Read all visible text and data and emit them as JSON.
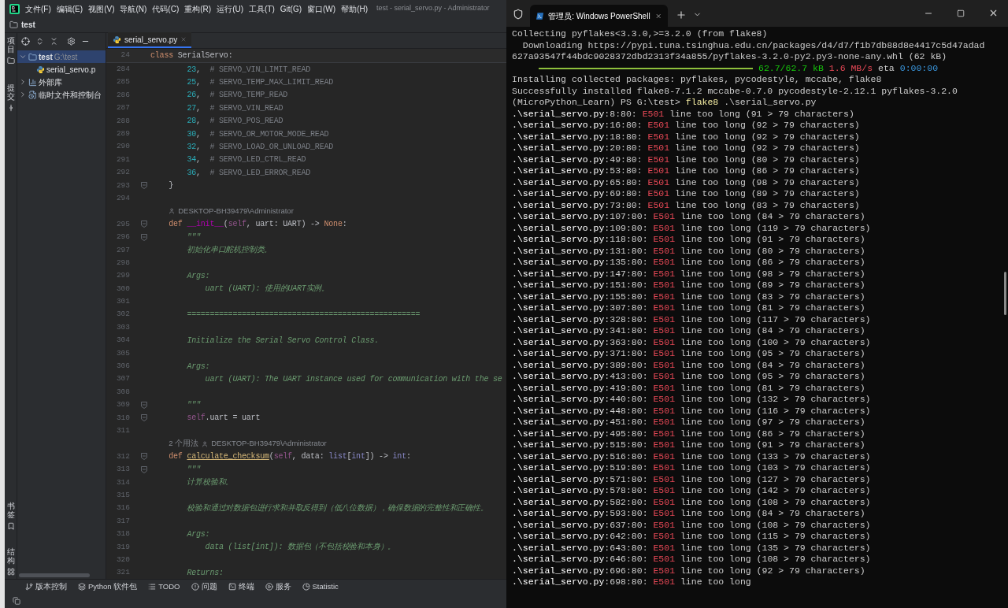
{
  "ide": {
    "menu": [
      "文件(F)",
      "编辑(E)",
      "视图(V)",
      "导航(N)",
      "代码(C)",
      "重构(R)",
      "运行(U)",
      "工具(T)",
      "Git(G)",
      "窗口(W)",
      "帮助(H)"
    ],
    "window_title": "test - serial_servo.py - Administrator",
    "breadcrumb": "test",
    "stripe_top": [
      "项目",
      "提交"
    ],
    "stripe_bottom": [
      "书签",
      "结构"
    ],
    "project_tree": [
      {
        "name": "test",
        "path": "G:\\test",
        "kind": "folder",
        "expanded": true,
        "selected": true,
        "children": [
          {
            "name": "serial_servo.p",
            "kind": "python",
            "selected": false
          }
        ]
      },
      {
        "name": "外部库",
        "kind": "library",
        "expanded": false,
        "selected": false
      },
      {
        "name": "临时文件和控制台",
        "kind": "scratch",
        "expanded": false,
        "selected": false
      }
    ],
    "editor_tab": {
      "label": "serial_servo.py",
      "selected": true
    },
    "sticky_line": {
      "number": "24",
      "tokens": [
        {
          "kind": "keyword",
          "text": "class"
        },
        {
          "kind": "plain",
          "text": " SerialServo:"
        }
      ]
    },
    "lines": [
      {
        "kind": "body",
        "number": "284",
        "fold": false,
        "tokens": [
          {
            "kind": "number",
            "text": "23"
          },
          {
            "kind": "plain",
            "text": ","
          },
          {
            "kind": "comment",
            "text": "  # SERVO_VIN_LIMIT_READ"
          }
        ]
      },
      {
        "kind": "body",
        "number": "285",
        "fold": false,
        "tokens": [
          {
            "kind": "number",
            "text": "25"
          },
          {
            "kind": "plain",
            "text": ","
          },
          {
            "kind": "comment",
            "text": "  # SERVO_TEMP_MAX_LIMIT_READ"
          }
        ]
      },
      {
        "kind": "body",
        "number": "286",
        "fold": false,
        "tokens": [
          {
            "kind": "number",
            "text": "26"
          },
          {
            "kind": "plain",
            "text": ","
          },
          {
            "kind": "comment",
            "text": "  # SERVO_TEMP_READ"
          }
        ]
      },
      {
        "kind": "body",
        "number": "287",
        "fold": false,
        "tokens": [
          {
            "kind": "number",
            "text": "27"
          },
          {
            "kind": "plain",
            "text": ","
          },
          {
            "kind": "comment",
            "text": "  # SERVO_VIN_READ"
          }
        ]
      },
      {
        "kind": "body",
        "number": "288",
        "fold": false,
        "tokens": [
          {
            "kind": "number",
            "text": "28"
          },
          {
            "kind": "plain",
            "text": ","
          },
          {
            "kind": "comment",
            "text": "  # SERVO_POS_READ"
          }
        ]
      },
      {
        "kind": "body",
        "number": "289",
        "fold": false,
        "tokens": [
          {
            "kind": "number",
            "text": "30"
          },
          {
            "kind": "plain",
            "text": ","
          },
          {
            "kind": "comment",
            "text": "  # SERVO_OR_MOTOR_MODE_READ"
          }
        ]
      },
      {
        "kind": "body",
        "number": "290",
        "fold": false,
        "tokens": [
          {
            "kind": "number",
            "text": "32"
          },
          {
            "kind": "plain",
            "text": ","
          },
          {
            "kind": "comment",
            "text": "  # SERVO_LOAD_OR_UNLOAD_READ"
          }
        ]
      },
      {
        "kind": "body",
        "number": "291",
        "fold": false,
        "tokens": [
          {
            "kind": "number",
            "text": "34"
          },
          {
            "kind": "plain",
            "text": ","
          },
          {
            "kind": "comment",
            "text": "  # SERVO_LED_CTRL_READ"
          }
        ]
      },
      {
        "kind": "body",
        "number": "292",
        "fold": false,
        "tokens": [
          {
            "kind": "number",
            "text": "36"
          },
          {
            "kind": "plain",
            "text": ","
          },
          {
            "kind": "comment",
            "text": "  # SERVO_LED_ERROR_READ"
          }
        ]
      },
      {
        "kind": "member",
        "number": "293",
        "fold": true,
        "tokens": [
          {
            "kind": "plain",
            "text": "}"
          }
        ]
      },
      {
        "kind": "blank",
        "number": "294",
        "fold": false
      },
      {
        "kind": "hint",
        "author": "DESKTOP-BH39479\\Administrator"
      },
      {
        "kind": "member",
        "number": "295",
        "fold": true,
        "tokens": [
          {
            "kind": "keyword",
            "text": "def "
          },
          {
            "kind": "magic",
            "text": "__init__"
          },
          {
            "kind": "plain",
            "text": "("
          },
          {
            "kind": "self",
            "text": "self"
          },
          {
            "kind": "plain",
            "text": ", uart: UART) -> "
          },
          {
            "kind": "keyword",
            "text": "None"
          },
          {
            "kind": "plain",
            "text": ":"
          }
        ]
      },
      {
        "kind": "body",
        "number": "296",
        "fold": true,
        "tokens": [
          {
            "kind": "doc",
            "text": "\"\"\""
          }
        ]
      },
      {
        "kind": "body",
        "number": "297",
        "fold": false,
        "tokens": [
          {
            "kind": "doc",
            "text": "初始化串口舵机控制类。"
          }
        ]
      },
      {
        "kind": "blank",
        "number": "298",
        "fold": false
      },
      {
        "kind": "body",
        "number": "299",
        "fold": false,
        "tokens": [
          {
            "kind": "doc",
            "text": "Args:"
          }
        ]
      },
      {
        "kind": "nested",
        "number": "300",
        "fold": false,
        "tokens": [
          {
            "kind": "doc",
            "text": "uart (UART): 使用的UART实例。"
          }
        ]
      },
      {
        "kind": "blank",
        "number": "301",
        "fold": false
      },
      {
        "kind": "body",
        "number": "302",
        "fold": false,
        "tokens": [
          {
            "kind": "doc",
            "text": "==================================================="
          }
        ]
      },
      {
        "kind": "blank",
        "number": "303",
        "fold": false
      },
      {
        "kind": "body",
        "number": "304",
        "fold": false,
        "tokens": [
          {
            "kind": "doc",
            "text": "Initialize the Serial Servo Control Class."
          }
        ]
      },
      {
        "kind": "blank",
        "number": "305",
        "fold": false
      },
      {
        "kind": "body",
        "number": "306",
        "fold": false,
        "tokens": [
          {
            "kind": "doc",
            "text": "Args:"
          }
        ]
      },
      {
        "kind": "nested",
        "number": "307",
        "fold": false,
        "tokens": [
          {
            "kind": "doc",
            "text": "uart (UART): The UART instance used for communication with the se"
          }
        ]
      },
      {
        "kind": "blank",
        "number": "308",
        "fold": false
      },
      {
        "kind": "body",
        "number": "309",
        "fold": true,
        "tokens": [
          {
            "kind": "doc",
            "text": "\"\"\""
          }
        ]
      },
      {
        "kind": "body",
        "number": "310",
        "fold": true,
        "tokens": [
          {
            "kind": "self",
            "text": "self"
          },
          {
            "kind": "plain",
            "text": ".uart = uart"
          }
        ]
      },
      {
        "kind": "blank",
        "number": "311",
        "fold": false
      },
      {
        "kind": "hint",
        "usages": "2 个用法",
        "author": "DESKTOP-BH39479\\Administrator"
      },
      {
        "kind": "member",
        "number": "312",
        "fold": true,
        "tokens": [
          {
            "kind": "keyword",
            "text": "def "
          },
          {
            "kind": "function",
            "text": "calculate_checksum"
          },
          {
            "kind": "plain",
            "text": "("
          },
          {
            "kind": "self",
            "text": "self"
          },
          {
            "kind": "plain",
            "text": ", data: "
          },
          {
            "kind": "builtin",
            "text": "list"
          },
          {
            "kind": "plain",
            "text": "["
          },
          {
            "kind": "builtin",
            "text": "int"
          },
          {
            "kind": "plain",
            "text": "]) -> "
          },
          {
            "kind": "builtin",
            "text": "int"
          },
          {
            "kind": "plain",
            "text": ":"
          }
        ]
      },
      {
        "kind": "body",
        "number": "313",
        "fold": true,
        "tokens": [
          {
            "kind": "doc",
            "text": "\"\"\""
          }
        ]
      },
      {
        "kind": "body",
        "number": "314",
        "fold": false,
        "tokens": [
          {
            "kind": "doc",
            "text": "计算校验和。"
          }
        ]
      },
      {
        "kind": "blank",
        "number": "315",
        "fold": false
      },
      {
        "kind": "body",
        "number": "316",
        "fold": false,
        "tokens": [
          {
            "kind": "doc",
            "text": "校验和通过对数据包进行求和并取反得到（低八位数据），确保数据的完整性和正确性。"
          }
        ]
      },
      {
        "kind": "blank",
        "number": "317",
        "fold": false
      },
      {
        "kind": "body",
        "number": "318",
        "fold": false,
        "tokens": [
          {
            "kind": "doc",
            "text": "Args:"
          }
        ]
      },
      {
        "kind": "nested",
        "number": "319",
        "fold": false,
        "tokens": [
          {
            "kind": "doc",
            "text": "data (list[int]): 数据包（不包括校验和本身）。"
          }
        ]
      },
      {
        "kind": "blank",
        "number": "320",
        "fold": false
      },
      {
        "kind": "body",
        "number": "321",
        "fold": false,
        "tokens": [
          {
            "kind": "doc",
            "text": "Returns:"
          }
        ]
      }
    ],
    "tool_windows": [
      "版本控制",
      "Python 软件包",
      "TODO",
      "问题",
      "终端",
      "服务",
      "Statistic"
    ]
  },
  "terminal": {
    "tab_title": "管理员: Windows PowerShell",
    "lines_before": [
      "Collecting pyflakes<3.3.0,>=3.2.0 (from flake8)",
      "  Downloading https://pypi.tuna.tsinghua.edu.cn/packages/d4/d7/f1b7db88d8e4417c5d47adad",
      "627a93547f44bdc9028372dbd2313f34a855/pyflakes-3.2.0-py2.py3-none-any.whl (62 kB)"
    ],
    "download": {
      "level": 1,
      "size": "62.7/62.7 kB",
      "speed": "1.6 MB/s",
      "eta_label": "eta",
      "eta": "0:00:00"
    },
    "lines_after": [
      "Installing collected packages: pyflakes, pycodestyle, mccabe, flake8",
      "Successfully installed flake8-7.1.2 mccabe-0.7.0 pycodestyle-2.12.1 pyflakes-3.2.0"
    ],
    "prompt": {
      "prefix": "(MicroPython_Learn) PS G:\\test> ",
      "command": "flake8",
      "args": " .\\serial_servo.py"
    },
    "results": [
      {
        "file": ".\\serial_servo.py",
        "position": ":8:80:",
        "code": "E501",
        "message": "line too long (91 > 79 characters)"
      },
      {
        "file": ".\\serial_servo.py",
        "position": ":16:80:",
        "code": "E501",
        "message": "line too long (92 > 79 characters)"
      },
      {
        "file": ".\\serial_servo.py",
        "position": ":18:80:",
        "code": "E501",
        "message": "line too long (92 > 79 characters)"
      },
      {
        "file": ".\\serial_servo.py",
        "position": ":20:80:",
        "code": "E501",
        "message": "line too long (92 > 79 characters)"
      },
      {
        "file": ".\\serial_servo.py",
        "position": ":49:80:",
        "code": "E501",
        "message": "line too long (80 > 79 characters)"
      },
      {
        "file": ".\\serial_servo.py",
        "position": ":53:80:",
        "code": "E501",
        "message": "line too long (86 > 79 characters)"
      },
      {
        "file": ".\\serial_servo.py",
        "position": ":65:80:",
        "code": "E501",
        "message": "line too long (98 > 79 characters)"
      },
      {
        "file": ".\\serial_servo.py",
        "position": ":69:80:",
        "code": "E501",
        "message": "line too long (89 > 79 characters)"
      },
      {
        "file": ".\\serial_servo.py",
        "position": ":73:80:",
        "code": "E501",
        "message": "line too long (83 > 79 characters)"
      },
      {
        "file": ".\\serial_servo.py",
        "position": ":107:80:",
        "code": "E501",
        "message": "line too long (84 > 79 characters)"
      },
      {
        "file": ".\\serial_servo.py",
        "position": ":109:80:",
        "code": "E501",
        "message": "line too long (119 > 79 characters)"
      },
      {
        "file": ".\\serial_servo.py",
        "position": ":118:80:",
        "code": "E501",
        "message": "line too long (91 > 79 characters)"
      },
      {
        "file": ".\\serial_servo.py",
        "position": ":131:80:",
        "code": "E501",
        "message": "line too long (80 > 79 characters)"
      },
      {
        "file": ".\\serial_servo.py",
        "position": ":135:80:",
        "code": "E501",
        "message": "line too long (86 > 79 characters)"
      },
      {
        "file": ".\\serial_servo.py",
        "position": ":147:80:",
        "code": "E501",
        "message": "line too long (98 > 79 characters)"
      },
      {
        "file": ".\\serial_servo.py",
        "position": ":151:80:",
        "code": "E501",
        "message": "line too long (89 > 79 characters)"
      },
      {
        "file": ".\\serial_servo.py",
        "position": ":155:80:",
        "code": "E501",
        "message": "line too long (83 > 79 characters)"
      },
      {
        "file": ".\\serial_servo.py",
        "position": ":307:80:",
        "code": "E501",
        "message": "line too long (81 > 79 characters)"
      },
      {
        "file": ".\\serial_servo.py",
        "position": ":328:80:",
        "code": "E501",
        "message": "line too long (117 > 79 characters)"
      },
      {
        "file": ".\\serial_servo.py",
        "position": ":341:80:",
        "code": "E501",
        "message": "line too long (84 > 79 characters)"
      },
      {
        "file": ".\\serial_servo.py",
        "position": ":363:80:",
        "code": "E501",
        "message": "line too long (100 > 79 characters)"
      },
      {
        "file": ".\\serial_servo.py",
        "position": ":371:80:",
        "code": "E501",
        "message": "line too long (95 > 79 characters)"
      },
      {
        "file": ".\\serial_servo.py",
        "position": ":389:80:",
        "code": "E501",
        "message": "line too long (84 > 79 characters)"
      },
      {
        "file": ".\\serial_servo.py",
        "position": ":413:80:",
        "code": "E501",
        "message": "line too long (95 > 79 characters)"
      },
      {
        "file": ".\\serial_servo.py",
        "position": ":419:80:",
        "code": "E501",
        "message": "line too long (81 > 79 characters)"
      },
      {
        "file": ".\\serial_servo.py",
        "position": ":440:80:",
        "code": "E501",
        "message": "line too long (132 > 79 characters)"
      },
      {
        "file": ".\\serial_servo.py",
        "position": ":448:80:",
        "code": "E501",
        "message": "line too long (116 > 79 characters)"
      },
      {
        "file": ".\\serial_servo.py",
        "position": ":451:80:",
        "code": "E501",
        "message": "line too long (97 > 79 characters)"
      },
      {
        "file": ".\\serial_servo.py",
        "position": ":495:80:",
        "code": "E501",
        "message": "line too long (86 > 79 characters)"
      },
      {
        "file": ".\\serial_servo.py",
        "position": ":515:80:",
        "code": "E501",
        "message": "line too long (91 > 79 characters)"
      },
      {
        "file": ".\\serial_servo.py",
        "position": ":516:80:",
        "code": "E501",
        "message": "line too long (133 > 79 characters)"
      },
      {
        "file": ".\\serial_servo.py",
        "position": ":519:80:",
        "code": "E501",
        "message": "line too long (103 > 79 characters)"
      },
      {
        "file": ".\\serial_servo.py",
        "position": ":571:80:",
        "code": "E501",
        "message": "line too long (127 > 79 characters)"
      },
      {
        "file": ".\\serial_servo.py",
        "position": ":578:80:",
        "code": "E501",
        "message": "line too long (142 > 79 characters)"
      },
      {
        "file": ".\\serial_servo.py",
        "position": ":582:80:",
        "code": "E501",
        "message": "line too long (108 > 79 characters)"
      },
      {
        "file": ".\\serial_servo.py",
        "position": ":593:80:",
        "code": "E501",
        "message": "line too long (84 > 79 characters)"
      },
      {
        "file": ".\\serial_servo.py",
        "position": ":637:80:",
        "code": "E501",
        "message": "line too long (108 > 79 characters)"
      },
      {
        "file": ".\\serial_servo.py",
        "position": ":642:80:",
        "code": "E501",
        "message": "line too long (115 > 79 characters)"
      },
      {
        "file": ".\\serial_servo.py",
        "position": ":643:80:",
        "code": "E501",
        "message": "line too long (135 > 79 characters)"
      },
      {
        "file": ".\\serial_servo.py",
        "position": ":646:80:",
        "code": "E501",
        "message": "line too long (108 > 79 characters)"
      },
      {
        "file": ".\\serial_servo.py",
        "position": ":696:80:",
        "code": "E501",
        "message": "line too long (92 > 79 characters)"
      },
      {
        "file": ".\\serial_servo.py",
        "position": ":698:80:",
        "code": "E501",
        "message": "line too long"
      }
    ]
  }
}
